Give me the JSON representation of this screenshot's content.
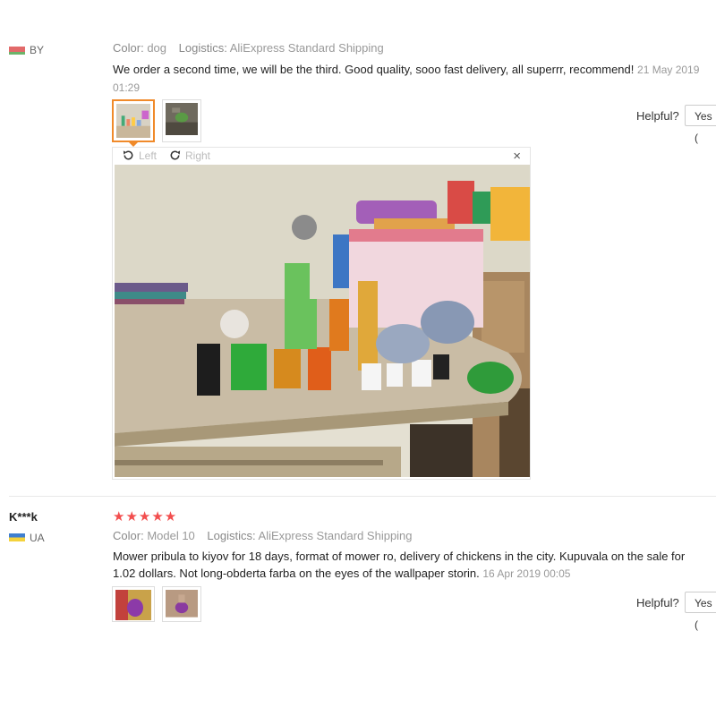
{
  "review1": {
    "country": "BY",
    "color_label": "Color:",
    "color_value": "dog",
    "logistics_label": "Logistics:",
    "logistics_value": "AliExpress Standard Shipping",
    "text": "We order a second time, we will be the third. Good quality, sooo fast delivery, all superrr, recommend!",
    "date": "21 May 2019 01:29",
    "helpful_label": "Helpful?",
    "yes_label": "Yes ("
  },
  "viewer": {
    "left_label": "Left",
    "right_label": "Right",
    "close_glyph": "×"
  },
  "review2": {
    "user": "K***k",
    "stars": "★★★★★",
    "rating": 5,
    "country": "UA",
    "color_label": "Color:",
    "color_value": "Model 10",
    "logistics_label": "Logistics:",
    "logistics_value": "AliExpress Standard Shipping",
    "text": "Mower pribula to kiyov for 18 days, format of mower ro, delivery of chickens in the city. Kupuvala on the sale for 1.02 dollars. Not long-obderta farba on the eyes of the wallpaper storin.",
    "date": "16 Apr 2019 00:05",
    "helpful_label": "Helpful?",
    "yes_label": "Yes ("
  },
  "colors": {
    "accent_orange": "#f08a2a",
    "star_red": "#f24e4e"
  }
}
